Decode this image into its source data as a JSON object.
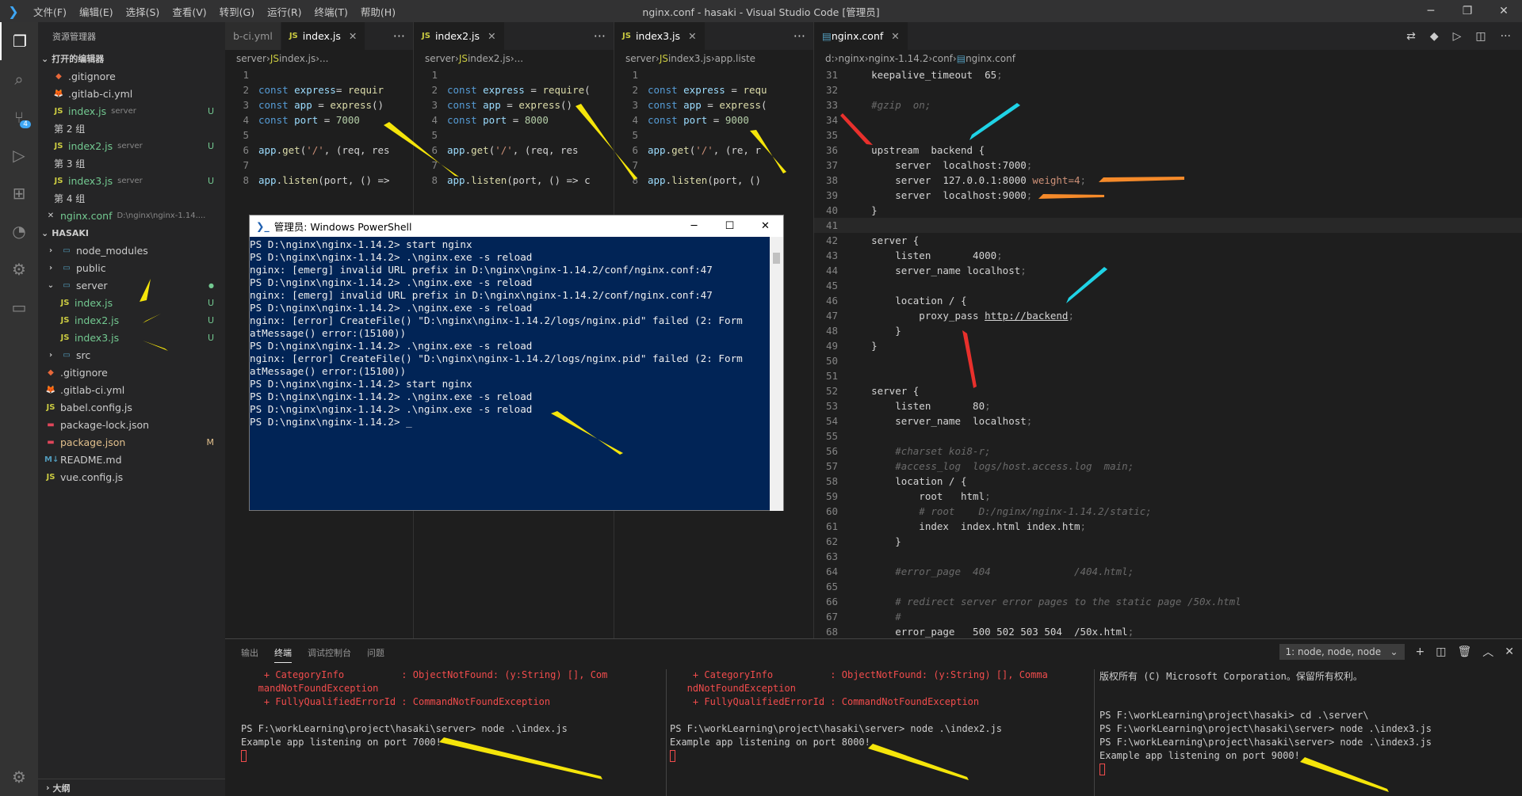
{
  "titlebar": {
    "title": "nginx.conf - hasaki - Visual Studio Code [管理员]",
    "menu": [
      "文件(F)",
      "编辑(E)",
      "选择(S)",
      "查看(V)",
      "转到(G)",
      "运行(R)",
      "终端(T)",
      "帮助(H)"
    ]
  },
  "activity_icons": [
    "files-icon",
    "search-icon",
    "source-control-icon",
    "run-debug-icon",
    "extensions-icon",
    "timeline-icon",
    "remote-icon",
    "folder-icon"
  ],
  "source_control_badge": "4",
  "sidebar": {
    "title": "资源管理器",
    "open_editors_header": "打开的编辑器",
    "open_editors": [
      {
        "icon": "git",
        "name": ".gitignore",
        "group": ""
      },
      {
        "icon": "gitlab",
        "name": ".gitlab-ci.yml",
        "group": ""
      },
      {
        "icon": "js",
        "name": "index.js",
        "sub": "server",
        "status": "U"
      },
      {
        "group_label": "第 2 组"
      },
      {
        "icon": "js",
        "name": "index2.js",
        "sub": "server",
        "status": "U"
      },
      {
        "group_label": "第 3 组"
      },
      {
        "icon": "js",
        "name": "index3.js",
        "sub": "server",
        "status": "U"
      },
      {
        "group_label": "第 4 组"
      },
      {
        "icon": "close",
        "name": "nginx.conf",
        "sub": "D:\\nginx\\nginx-1.14...."
      }
    ],
    "project_header": "HASAKI",
    "tree": [
      {
        "name": "node_modules",
        "type": "folder",
        "indent": 1,
        "collapsed": true
      },
      {
        "name": "public",
        "type": "folder",
        "indent": 1,
        "collapsed": true
      },
      {
        "name": "server",
        "type": "folder-open",
        "indent": 1,
        "status": "●"
      },
      {
        "name": "index.js",
        "type": "js",
        "indent": 2,
        "status": "U"
      },
      {
        "name": "index2.js",
        "type": "js",
        "indent": 2,
        "status": "U"
      },
      {
        "name": "index3.js",
        "type": "js",
        "indent": 2,
        "status": "U"
      },
      {
        "name": "src",
        "type": "folder",
        "indent": 1,
        "collapsed": true
      },
      {
        "name": ".gitignore",
        "type": "git",
        "indent": 1
      },
      {
        "name": ".gitlab-ci.yml",
        "type": "gitlab",
        "indent": 1
      },
      {
        "name": "babel.config.js",
        "type": "js",
        "indent": 1
      },
      {
        "name": "package-lock.json",
        "type": "pkg",
        "indent": 1
      },
      {
        "name": "package.json",
        "type": "pkg",
        "indent": 1,
        "status": "M"
      },
      {
        "name": "README.md",
        "type": "md",
        "indent": 1
      },
      {
        "name": "vue.config.js",
        "type": "js",
        "indent": 1
      }
    ],
    "outline_header": "大纲"
  },
  "pane1": {
    "tabs": [
      {
        "label": "b-ci.yml"
      },
      {
        "label": "index.js",
        "active": true
      }
    ],
    "crumb": [
      "server",
      "index.js",
      "..."
    ],
    "lines": [
      {
        "n": "1",
        "code": []
      },
      {
        "n": "2",
        "code": [
          [
            "kw",
            "const "
          ],
          [
            "var",
            "express"
          ],
          [
            "",
            "= "
          ],
          [
            "fn",
            "requir"
          ]
        ]
      },
      {
        "n": "3",
        "code": [
          [
            "kw",
            "const "
          ],
          [
            "var",
            "app "
          ],
          [
            "",
            "= "
          ],
          [
            "fn",
            "express"
          ],
          [
            "",
            "()"
          ]
        ]
      },
      {
        "n": "4",
        "code": [
          [
            "kw",
            "const "
          ],
          [
            "var",
            "port "
          ],
          [
            "",
            "= "
          ],
          [
            "num",
            "7000"
          ]
        ]
      },
      {
        "n": "5",
        "code": []
      },
      {
        "n": "6",
        "code": [
          [
            "var",
            "app"
          ],
          [
            "",
            "."
          ],
          [
            "fn",
            "get"
          ],
          [
            "",
            "("
          ],
          [
            "str",
            "'/'"
          ],
          [
            "",
            ", (req, res"
          ]
        ]
      },
      {
        "n": "7",
        "code": []
      },
      {
        "n": "8",
        "code": [
          [
            "var",
            "app"
          ],
          [
            "",
            "."
          ],
          [
            "fn",
            "listen"
          ],
          [
            "",
            "(port, () =>"
          ]
        ]
      }
    ]
  },
  "pane2": {
    "tabs": [
      {
        "label": "index2.js",
        "active": true
      }
    ],
    "crumb": [
      "server",
      "index2.js",
      "..."
    ],
    "lines": [
      {
        "n": "1",
        "code": []
      },
      {
        "n": "2",
        "code": [
          [
            "kw",
            "const "
          ],
          [
            "var",
            "express "
          ],
          [
            "",
            "= "
          ],
          [
            "fn",
            "require"
          ],
          [
            "",
            "("
          ]
        ]
      },
      {
        "n": "3",
        "code": [
          [
            "kw",
            "const "
          ],
          [
            "var",
            "app "
          ],
          [
            "",
            "= "
          ],
          [
            "fn",
            "express"
          ],
          [
            "",
            "()"
          ]
        ]
      },
      {
        "n": "4",
        "code": [
          [
            "kw",
            "const "
          ],
          [
            "var",
            "port "
          ],
          [
            "",
            "= "
          ],
          [
            "num",
            "8000"
          ]
        ]
      },
      {
        "n": "5",
        "code": []
      },
      {
        "n": "6",
        "code": [
          [
            "var",
            "app"
          ],
          [
            "",
            "."
          ],
          [
            "fn",
            "get"
          ],
          [
            "",
            "("
          ],
          [
            "str",
            "'/'"
          ],
          [
            "",
            ", (req, res"
          ]
        ]
      },
      {
        "n": "7",
        "code": []
      },
      {
        "n": "8",
        "code": [
          [
            "var",
            "app"
          ],
          [
            "",
            "."
          ],
          [
            "fn",
            "listen"
          ],
          [
            "",
            "(port, () => c"
          ]
        ]
      }
    ]
  },
  "pane3": {
    "tabs": [
      {
        "label": "index3.js",
        "active": true
      }
    ],
    "crumb": [
      "server",
      "index3.js",
      "app.liste"
    ],
    "lines": [
      {
        "n": "1",
        "code": []
      },
      {
        "n": "2",
        "code": [
          [
            "kw",
            "const "
          ],
          [
            "var",
            "express "
          ],
          [
            "",
            "= "
          ],
          [
            "fn",
            "requ"
          ]
        ]
      },
      {
        "n": "3",
        "code": [
          [
            "kw",
            "const "
          ],
          [
            "var",
            "app "
          ],
          [
            "",
            "= "
          ],
          [
            "fn",
            "express"
          ],
          [
            "",
            "("
          ]
        ]
      },
      {
        "n": "4",
        "code": [
          [
            "kw",
            "const "
          ],
          [
            "var",
            "port "
          ],
          [
            "",
            "= "
          ],
          [
            "num",
            "9000"
          ]
        ]
      },
      {
        "n": "5",
        "code": []
      },
      {
        "n": "6",
        "code": [
          [
            "var",
            "app"
          ],
          [
            "",
            "."
          ],
          [
            "fn",
            "get"
          ],
          [
            "",
            "("
          ],
          [
            "str",
            "'/'"
          ],
          [
            "",
            ", (re, r"
          ]
        ]
      },
      {
        "n": "7",
        "code": []
      },
      {
        "n": "8",
        "code": [
          [
            "var",
            "app"
          ],
          [
            "",
            "."
          ],
          [
            "fn",
            "listen"
          ],
          [
            "",
            "(port, ()"
          ]
        ]
      }
    ]
  },
  "pane4": {
    "tab": "nginx.conf",
    "crumb": [
      "d:",
      "nginx",
      "nginx-1.14.2",
      "conf",
      "nginx.conf"
    ],
    "lines": [
      {
        "n": "31",
        "code": [
          [
            "",
            "    keepalive_timeout  65"
          ],
          [
            "semi",
            ";"
          ]
        ]
      },
      {
        "n": "32",
        "code": []
      },
      {
        "n": "33",
        "code": [
          [
            "cmt",
            "    #gzip  on;"
          ]
        ]
      },
      {
        "n": "34",
        "code": []
      },
      {
        "n": "35",
        "code": []
      },
      {
        "n": "36",
        "code": [
          [
            "",
            "    upstream  backend {"
          ]
        ]
      },
      {
        "n": "37",
        "code": [
          [
            "",
            "        server  localhost:7000"
          ],
          [
            "semi",
            ";"
          ]
        ]
      },
      {
        "n": "38",
        "code": [
          [
            "",
            "        server  127.0.0.1:8000 "
          ],
          [
            "str",
            "weight=4"
          ],
          [
            "semi",
            ";"
          ]
        ]
      },
      {
        "n": "39",
        "code": [
          [
            "",
            "        server  localhost:9000"
          ],
          [
            "semi",
            ";"
          ]
        ]
      },
      {
        "n": "40",
        "code": [
          [
            "",
            "    }"
          ]
        ]
      },
      {
        "n": "41",
        "code": []
      },
      {
        "n": "42",
        "code": [
          [
            "",
            "    server {"
          ]
        ]
      },
      {
        "n": "43",
        "code": [
          [
            "",
            "        listen       4000"
          ],
          [
            "semi",
            ";"
          ]
        ]
      },
      {
        "n": "44",
        "code": [
          [
            "",
            "        server_name localhost"
          ],
          [
            "semi",
            ";"
          ]
        ]
      },
      {
        "n": "45",
        "code": []
      },
      {
        "n": "46",
        "code": [
          [
            "",
            "        location / {"
          ]
        ]
      },
      {
        "n": "47",
        "code": [
          [
            "",
            "            proxy_pass "
          ],
          [
            "url",
            "http://backend"
          ],
          [
            "semi",
            ";"
          ]
        ]
      },
      {
        "n": "48",
        "code": [
          [
            "",
            "        }"
          ]
        ]
      },
      {
        "n": "49",
        "code": [
          [
            "",
            "    }"
          ]
        ]
      },
      {
        "n": "50",
        "code": []
      },
      {
        "n": "51",
        "code": []
      },
      {
        "n": "52",
        "code": [
          [
            "",
            "    server {"
          ]
        ]
      },
      {
        "n": "53",
        "code": [
          [
            "",
            "        listen       80"
          ],
          [
            "semi",
            ";"
          ]
        ]
      },
      {
        "n": "54",
        "code": [
          [
            "",
            "        server_name  localhost"
          ],
          [
            "semi",
            ";"
          ]
        ]
      },
      {
        "n": "55",
        "code": []
      },
      {
        "n": "56",
        "code": [
          [
            "cmt",
            "        #charset koi8-r;"
          ]
        ]
      },
      {
        "n": "57",
        "code": [
          [
            "cmt",
            "        #access_log  logs/host.access.log  main;"
          ]
        ]
      },
      {
        "n": "58",
        "code": [
          [
            "",
            "        location / {"
          ]
        ]
      },
      {
        "n": "59",
        "code": [
          [
            "",
            "            root   html"
          ],
          [
            "semi",
            ";"
          ]
        ]
      },
      {
        "n": "60",
        "code": [
          [
            "cmt",
            "            # root    D:/nginx/nginx-1.14.2/static;"
          ]
        ]
      },
      {
        "n": "61",
        "code": [
          [
            "",
            "            index  index.html index.htm"
          ],
          [
            "semi",
            ";"
          ]
        ]
      },
      {
        "n": "62",
        "code": [
          [
            "",
            "        }"
          ]
        ]
      },
      {
        "n": "63",
        "code": []
      },
      {
        "n": "64",
        "code": [
          [
            "cmt",
            "        #error_page  404              /404.html;"
          ]
        ]
      },
      {
        "n": "65",
        "code": []
      },
      {
        "n": "66",
        "code": [
          [
            "cmt",
            "        # redirect server error pages to the static page /50x.html"
          ]
        ]
      },
      {
        "n": "67",
        "code": [
          [
            "cmt",
            "        #"
          ]
        ]
      },
      {
        "n": "68",
        "code": [
          [
            "",
            "        error_page   500 502 503 504  /50x.html"
          ],
          [
            "semi",
            ";"
          ]
        ]
      },
      {
        "n": "69",
        "code": [
          [
            "",
            "        location = /50x.html {"
          ]
        ]
      }
    ]
  },
  "powershell": {
    "title": "管理员: Windows PowerShell",
    "lines": [
      "PS D:\\nginx\\nginx-1.14.2> start nginx",
      "PS D:\\nginx\\nginx-1.14.2> .\\nginx.exe -s reload",
      "nginx: [emerg] invalid URL prefix in D:\\nginx\\nginx-1.14.2/conf/nginx.conf:47",
      "PS D:\\nginx\\nginx-1.14.2> .\\nginx.exe -s reload",
      "nginx: [emerg] invalid URL prefix in D:\\nginx\\nginx-1.14.2/conf/nginx.conf:47",
      "PS D:\\nginx\\nginx-1.14.2> .\\nginx.exe -s reload",
      "nginx: [error] CreateFile() \"D:\\nginx\\nginx-1.14.2/logs/nginx.pid\" failed (2: Form",
      "atMessage() error:(15100))",
      "PS D:\\nginx\\nginx-1.14.2> .\\nginx.exe -s reload",
      "nginx: [error] CreateFile() \"D:\\nginx\\nginx-1.14.2/logs/nginx.pid\" failed (2: Form",
      "atMessage() error:(15100))",
      "PS D:\\nginx\\nginx-1.14.2> start nginx",
      "PS D:\\nginx\\nginx-1.14.2> .\\nginx.exe -s reload",
      "PS D:\\nginx\\nginx-1.14.2> .\\nginx.exe -s reload",
      "PS D:\\nginx\\nginx-1.14.2> _"
    ]
  },
  "panel": {
    "tabs": [
      "输出",
      "终端",
      "调试控制台",
      "问题"
    ],
    "active_tab": "终端",
    "terminal_select": "1: node, node, node",
    "term1": [
      [
        "err",
        "    + CategoryInfo          : ObjectNotFound: (y:String) [], Com"
      ],
      [
        "err",
        "   mandNotFoundException"
      ],
      [
        "err",
        "    + FullyQualifiedErrorId : CommandNotFoundException"
      ],
      [
        "",
        ""
      ],
      [
        "",
        "PS F:\\workLearning\\project\\hasaki\\server> node .\\index.js"
      ],
      [
        "",
        "Example app listening on port 7000!"
      ]
    ],
    "term2": [
      [
        "err",
        "    + CategoryInfo          : ObjectNotFound: (y:String) [], Comma"
      ],
      [
        "err",
        "   ndNotFoundException"
      ],
      [
        "err",
        "    + FullyQualifiedErrorId : CommandNotFoundException"
      ],
      [
        "",
        ""
      ],
      [
        "",
        "PS F:\\workLearning\\project\\hasaki\\server> node .\\index2.js"
      ],
      [
        "",
        "Example app listening on port 8000!"
      ]
    ],
    "term3": [
      [
        "",
        "版权所有 (C) Microsoft Corporation。保留所有权利。"
      ],
      [
        "",
        ""
      ],
      [
        "",
        ""
      ],
      [
        "",
        "PS F:\\workLearning\\project\\hasaki> cd .\\server\\"
      ],
      [
        "",
        "PS F:\\workLearning\\project\\hasaki\\server> node .\\index3.js"
      ],
      [
        "",
        "PS F:\\workLearning\\project\\hasaki\\server> node .\\index3.js"
      ],
      [
        "",
        "Example app listening on port 9000!"
      ]
    ]
  },
  "colors": {
    "accent": "#007acc",
    "annotation_yellow": "#f5e50a",
    "annotation_cyan": "#1fd3e6",
    "annotation_red": "#e8302c",
    "annotation_orange": "#f58a2a"
  }
}
